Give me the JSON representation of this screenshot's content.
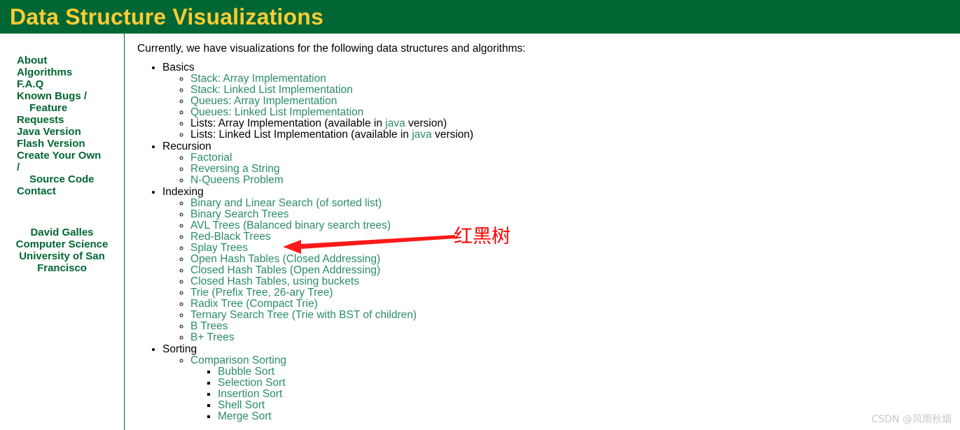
{
  "header": {
    "title": "Data Structure Visualizations",
    "bg_color": "#006633",
    "text_color": "#ffcc33"
  },
  "sidebar": {
    "items": [
      {
        "label": "About"
      },
      {
        "label": "Algorithms"
      },
      {
        "label": "F.A.Q"
      },
      {
        "label": "Known Bugs /",
        "label_line2": "Feature",
        "label_line3": "Requests"
      },
      {
        "label": "Java Version"
      },
      {
        "label": "Flash Version"
      },
      {
        "label": "Create Your Own",
        "label_line2": "/",
        "label_line3": "Source Code"
      },
      {
        "label": "Contact"
      }
    ],
    "footer": {
      "line1": "David Galles",
      "line2": "Computer Science",
      "line3": "University of San",
      "line4": "Francisco"
    },
    "link_color": "#006633"
  },
  "main": {
    "intro": "Currently, we have visualizations for the following data structures and algorithms:",
    "link_color": "#2b8c6a",
    "sections": [
      {
        "title": "Basics",
        "items": [
          {
            "text": "Stack: Array Implementation",
            "type": "link"
          },
          {
            "text": "Stack: Linked List Implementation",
            "type": "link"
          },
          {
            "text": "Queues: Array Implementation",
            "type": "link"
          },
          {
            "text": "Queues: Linked List Implementation",
            "type": "link"
          },
          {
            "text": "Lists: Array Implementation (available in ",
            "type": "mixed",
            "link_text": "java",
            "text_after": " version)"
          },
          {
            "text": "Lists: Linked List Implementation (available in ",
            "type": "mixed",
            "link_text": "java",
            "text_after": " version)"
          }
        ]
      },
      {
        "title": "Recursion",
        "items": [
          {
            "text": "Factorial",
            "type": "link"
          },
          {
            "text": "Reversing a String",
            "type": "link"
          },
          {
            "text": "N-Queens Problem",
            "type": "link"
          }
        ]
      },
      {
        "title": "Indexing",
        "items": [
          {
            "text": "Binary and Linear Search (of sorted list)",
            "type": "link"
          },
          {
            "text": "Binary Search Trees",
            "type": "link"
          },
          {
            "text": "AVL Trees (Balanced binary search trees)",
            "type": "link"
          },
          {
            "text": "Red-Black Trees",
            "type": "link"
          },
          {
            "text": "Splay Trees",
            "type": "link"
          },
          {
            "text": "Open Hash Tables (Closed Addressing)",
            "type": "link"
          },
          {
            "text": "Closed Hash Tables (Open Addressing)",
            "type": "link"
          },
          {
            "text": "Closed Hash Tables, using buckets",
            "type": "link"
          },
          {
            "text": "Trie (Prefix Tree, 26-ary Tree)",
            "type": "link"
          },
          {
            "text": "Radix Tree (Compact Trie)",
            "type": "link"
          },
          {
            "text": "Ternary Search Tree (Trie with BST of children)",
            "type": "link"
          },
          {
            "text": "B Trees",
            "type": "link"
          },
          {
            "text": "B+ Trees",
            "type": "link"
          }
        ]
      },
      {
        "title": "Sorting",
        "items": [
          {
            "text": "Comparison Sorting",
            "type": "link"
          }
        ],
        "sub_items": [
          {
            "text": "Bubble Sort",
            "type": "link"
          },
          {
            "text": "Selection Sort",
            "type": "link"
          },
          {
            "text": "Insertion Sort",
            "type": "link"
          },
          {
            "text": "Shell Sort",
            "type": "link"
          },
          {
            "text": "Merge Sort",
            "type": "link"
          }
        ]
      }
    ]
  },
  "annotation": {
    "text": "红黑树",
    "color": "#ff0000",
    "target": "Red-Black Trees"
  },
  "watermark": {
    "text": "CSDN @风雨秋烟",
    "color": "#c9c9c9"
  }
}
